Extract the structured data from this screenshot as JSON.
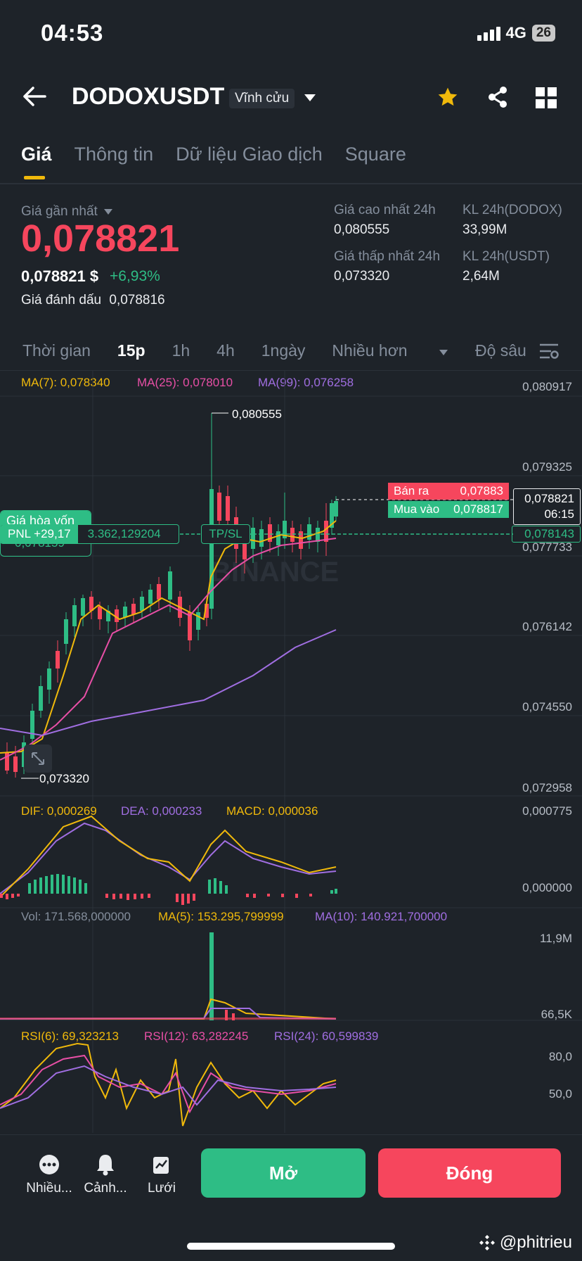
{
  "status": {
    "time": "04:53",
    "network": "4G",
    "battery": "26"
  },
  "header": {
    "symbol": "DODOXUSDT",
    "contract_type": "Vĩnh cửu"
  },
  "tabs": [
    "Giá",
    "Thông tin",
    "Dữ liệu Giao dịch",
    "Square"
  ],
  "price": {
    "last_label": "Giá gần nhất",
    "last": "0,078821",
    "usd": "0,078821 $",
    "change": "+6,93%",
    "mark_label": "Giá đánh dấu",
    "mark": "0,078816"
  },
  "stats": {
    "high_label": "Giá cao nhất 24h",
    "high": "0,080555",
    "vol_base_label": "KL 24h(DODOX)",
    "vol_base": "33,99M",
    "low_label": "Giá thấp nhất 24h",
    "low": "0,073320",
    "vol_quote_label": "KL 24h(USDT)",
    "vol_quote": "2,64M"
  },
  "timeframes": {
    "time": "Thời gian",
    "m15": "15p",
    "h1": "1h",
    "h4": "4h",
    "d1": "1ngày",
    "more": "Nhiều hơn",
    "depth": "Độ sâu"
  },
  "ma": {
    "ma7": "MA(7): 0,078340",
    "ma25": "MA(25): 0,078010",
    "ma99": "MA(99): 0,076258"
  },
  "price_axis": [
    "0,080917",
    "0,079325",
    "0,077733",
    "0,076142",
    "0,074550",
    "0,072958"
  ],
  "annotations": {
    "high": "0,080555",
    "low": "0,073320"
  },
  "orders": {
    "sell_label": "Bán ra",
    "sell": "0,07883",
    "buy_label": "Mua vào",
    "buy": "0,078817",
    "current_price": "0,078821",
    "countdown": "06:15",
    "entry_line_price": "0,078143"
  },
  "position": {
    "breakeven_label": "Giá hòa vốn",
    "breakeven_value": "0,078159",
    "pnl": "PNL +29,17",
    "qty": "3.362,129204",
    "tpsl": "TP/SL"
  },
  "watermark_chart": "BINANCE",
  "macd": {
    "dif": "DIF: 0,000269",
    "dea": "DEA: 0,000233",
    "macd": "MACD: 0,000036",
    "axis_top": "0,000775",
    "axis_mid": "0,000000"
  },
  "volume": {
    "vol": "Vol: 171.568,000000",
    "ma5": "MA(5): 153.295,799999",
    "ma10": "MA(10): 140.921,700000",
    "axis_top": "11,9M",
    "axis_bottom": "66,5K"
  },
  "rsi": {
    "rsi6": "RSI(6): 69,323213",
    "rsi12": "RSI(12): 63,282245",
    "rsi24": "RSI(24): 60,599839",
    "axis_80": "80,0",
    "axis_50": "50,0"
  },
  "nav": {
    "more": "Nhiều...",
    "alert": "Cảnh...",
    "grid": "Lưới"
  },
  "actions": {
    "open": "Mở",
    "close": "Đóng"
  },
  "credit": "@phitrieu",
  "colors": {
    "up": "#2ebd85",
    "down": "#f6465d",
    "accent": "#f0b90b",
    "ma25": "#e84fa6",
    "ma99": "#a06ee1"
  }
}
